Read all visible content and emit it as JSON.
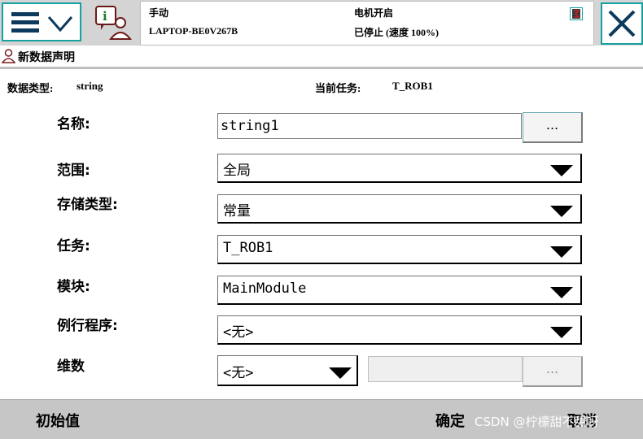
{
  "header": {
    "mode": "手动",
    "controller": "LAPTOP-BE0V267B",
    "motor_state": "电机开启",
    "run_state": "已停止 (速度 100%)"
  },
  "dialog": {
    "title": "新数据声明",
    "data_type_label": "数据类型:",
    "data_type_value": "string",
    "current_task_label": "当前任务:",
    "current_task_value": "T_ROB1"
  },
  "form": {
    "name_label": "名称:",
    "name_value": "string1",
    "name_browse": "...",
    "scope_label": "范围:",
    "scope_value": "全局",
    "storage_label": "存储类型:",
    "storage_value": "常量",
    "task_label": "任务:",
    "task_value": "T_ROB1",
    "module_label": "模块:",
    "module_value": "MainModule",
    "routine_label": "例行程序:",
    "routine_value": "<无>",
    "dimension_label": "维数",
    "dimension_value": "<无>",
    "dimension_browse": "..."
  },
  "footer": {
    "initial_value": "初始值",
    "ok": "确定",
    "cancel": "取消",
    "watermark": "CSDN @柠檬甜不甜呀"
  },
  "colors": {
    "accent": "#14a1a0",
    "toolbar_bg": "#d4d4d4",
    "footer_bg": "#c6c6c6"
  }
}
